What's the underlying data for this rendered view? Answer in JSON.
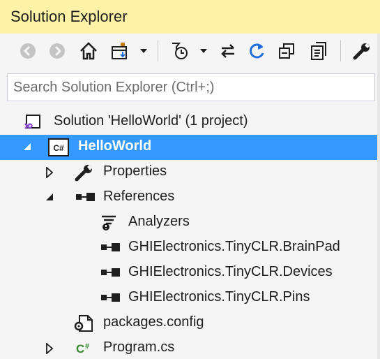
{
  "window": {
    "title": "Solution Explorer"
  },
  "toolbar": {
    "buttons": [
      {
        "name": "back-button",
        "icon": "back-arrow-icon"
      },
      {
        "name": "forward-button",
        "icon": "forward-arrow-icon"
      },
      {
        "name": "home-button",
        "icon": "home-icon"
      },
      {
        "name": "switch-views-button",
        "icon": "switch-views-icon"
      },
      {
        "name": "switch-views-dropdown",
        "icon": "chevron-down-icon"
      },
      {
        "name": "pending-changes-filter-button",
        "icon": "clock-filter-icon"
      },
      {
        "name": "pending-changes-dropdown",
        "icon": "chevron-down-icon"
      },
      {
        "name": "sync-active-document-button",
        "icon": "sync-arrows-icon"
      },
      {
        "name": "refresh-button",
        "icon": "refresh-icon"
      },
      {
        "name": "collapse-all-button",
        "icon": "collapse-all-icon"
      },
      {
        "name": "show-all-files-button",
        "icon": "show-all-files-icon"
      },
      {
        "name": "properties-button",
        "icon": "wrench-icon"
      }
    ]
  },
  "search": {
    "placeholder": "Search Solution Explorer (Ctrl+;)",
    "value": ""
  },
  "tree": {
    "solution": {
      "label": "Solution 'HelloWorld' (1 project)",
      "icon": "visual-studio-solution-icon"
    },
    "project": {
      "label": "HelloWorld",
      "icon": "csharp-project-icon",
      "expanded": true,
      "selected": true
    },
    "properties": {
      "label": "Properties",
      "icon": "wrench-icon",
      "expanded": false
    },
    "references": {
      "label": "References",
      "icon": "references-icon",
      "expanded": true
    },
    "reference_items": [
      {
        "label": "Analyzers",
        "icon": "analyzer-icon"
      },
      {
        "label": "GHIElectronics.TinyCLR.BrainPad",
        "icon": "reference-icon"
      },
      {
        "label": "GHIElectronics.TinyCLR.Devices",
        "icon": "reference-icon"
      },
      {
        "label": "GHIElectronics.TinyCLR.Pins",
        "icon": "reference-icon"
      }
    ],
    "packages_config": {
      "label": "packages.config",
      "icon": "config-file-icon"
    },
    "program_cs": {
      "label": "Program.cs",
      "icon": "csharp-file-icon",
      "expanded": false
    }
  },
  "colors": {
    "title_bar": "#fdf2a6",
    "selection": "#3399ff",
    "accent_blue": "#1e6fd9",
    "csharp_green": "#388a34"
  }
}
